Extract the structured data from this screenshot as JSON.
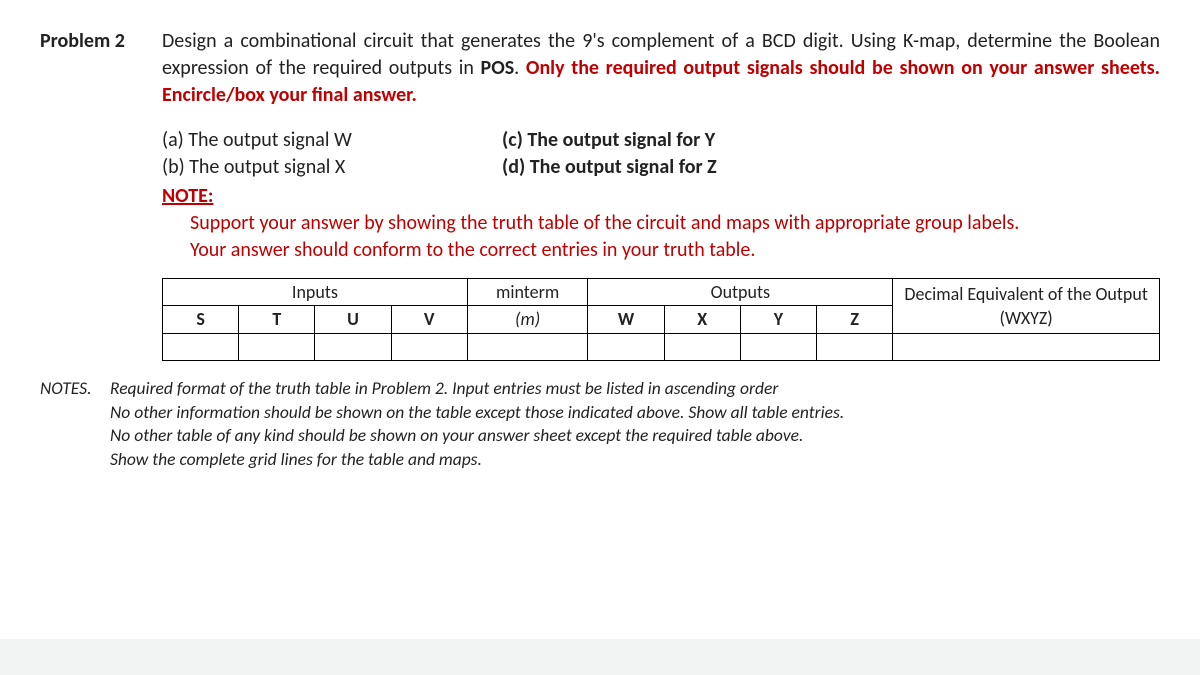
{
  "problem": {
    "label": "Problem 2",
    "desc_black1": "Design a combinational circuit that generates the 9's complement of a BCD digit. Using K-map, determine the Boolean expression of the required outputs in ",
    "pos": "POS",
    "period": ". ",
    "desc_red": "Only the required output signals should be shown on your answer sheets. Encircle/box your final answer."
  },
  "parts": {
    "a": "(a) The output signal W",
    "b": "(b) The output signal X",
    "c": "(c) The output signal for Y",
    "d": "(d) The output signal for Z"
  },
  "note": {
    "head": "NOTE:",
    "line1": "Support your answer by showing the truth table of the circuit and maps with appropriate group labels.",
    "line2": "Your answer should conform to the correct entries in your truth table."
  },
  "table": {
    "inputs_label": "Inputs",
    "minterm_label": "minterm",
    "outputs_label": "Outputs",
    "dec_label": "Decimal Equivalent of the Output (WXYZ)",
    "S": "S",
    "T": "T",
    "U": "U",
    "V": "V",
    "m": "(m)",
    "W": "W",
    "X": "X",
    "Y": "Y",
    "Z": "Z"
  },
  "notes2": {
    "lead": "NOTES.",
    "l1": "Required format of the truth table in Problem 2. Input entries must be listed in ascending order",
    "l2": "No other information should be shown on the table except those indicated above. Show all table entries.",
    "l3": "No other table of any kind should be shown on your answer sheet except the required table above.",
    "l4": "Show the complete grid lines for the table and maps."
  }
}
